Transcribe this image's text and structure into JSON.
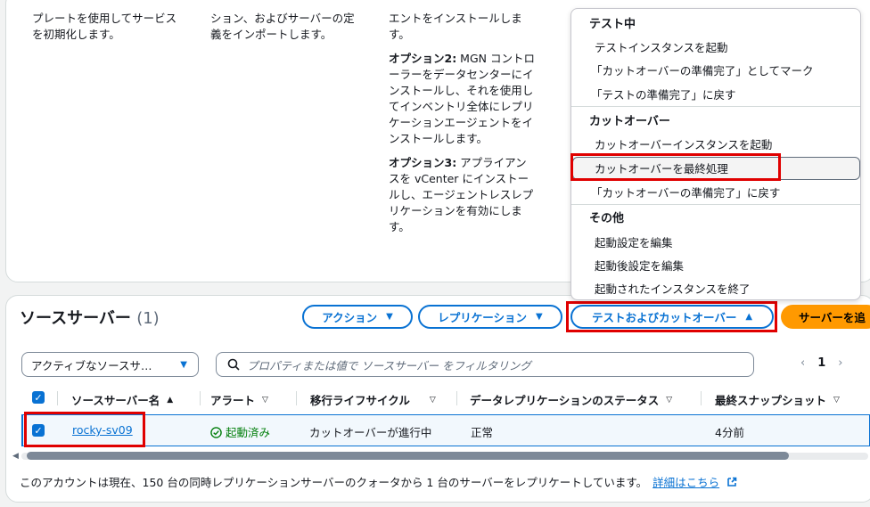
{
  "steps": {
    "col1": "プレートを使用してサービスを初期化します。",
    "col2": "ション、およびサーバーの定義をインポートします。",
    "col3_intro": "エントをインストールします。",
    "col3_opt2_label": "オプション2:",
    "col3_opt2_text": " MGN コントローラーをデータセンターにインストールし、それを使用してインベントリ全体にレプリケーションエージェントをインストールします。",
    "col3_opt3_label": "オプション3:",
    "col3_opt3_text": " アプライアンスを vCenter にインストールし、エージェントレスレプリケーションを有効にします。"
  },
  "menu": {
    "group_test": "テスト中",
    "test_items": [
      "テストインスタンスを起動",
      "「カットオーバーの準備完了」としてマーク",
      "「テストの準備完了」に戻す"
    ],
    "group_cutover": "カットオーバー",
    "cutover_items": [
      "カットオーバーインスタンスを起動",
      "カットオーバーを最終処理",
      "「カットオーバーの準備完了」に戻す"
    ],
    "group_other": "その他",
    "other_items": [
      "起動設定を編集",
      "起動後設定を編集",
      "起動されたインスタンスを終了"
    ]
  },
  "source": {
    "title": "ソースサーバー",
    "count": "(1)",
    "actions_label": "アクション",
    "replication_label": "レプリケーション",
    "test_cutover_label": "テストおよびカットオーバー",
    "add_server_label": "サーバーを追",
    "filter_select": "アクティブなソースサ…",
    "search_placeholder": "プロパティまたは値で ソースサーバー をフィルタリング",
    "page": "1",
    "columns": [
      "ソースサーバー名",
      "アラート",
      "移行ライフサイクル",
      "データレプリケーションのステータス",
      "最終スナップショット"
    ],
    "row": {
      "name": "rocky-sv09",
      "alert": "起動済み",
      "lifecycle": "カットオーバーが進行中",
      "replication": "正常",
      "snapshot": "4分前"
    },
    "footer_text": "このアカウントは現在、150 台の同時レプリケーションサーバーのクォータから 1 台のサーバーをレプリケートしています。",
    "footer_link": "詳細はこちら"
  }
}
